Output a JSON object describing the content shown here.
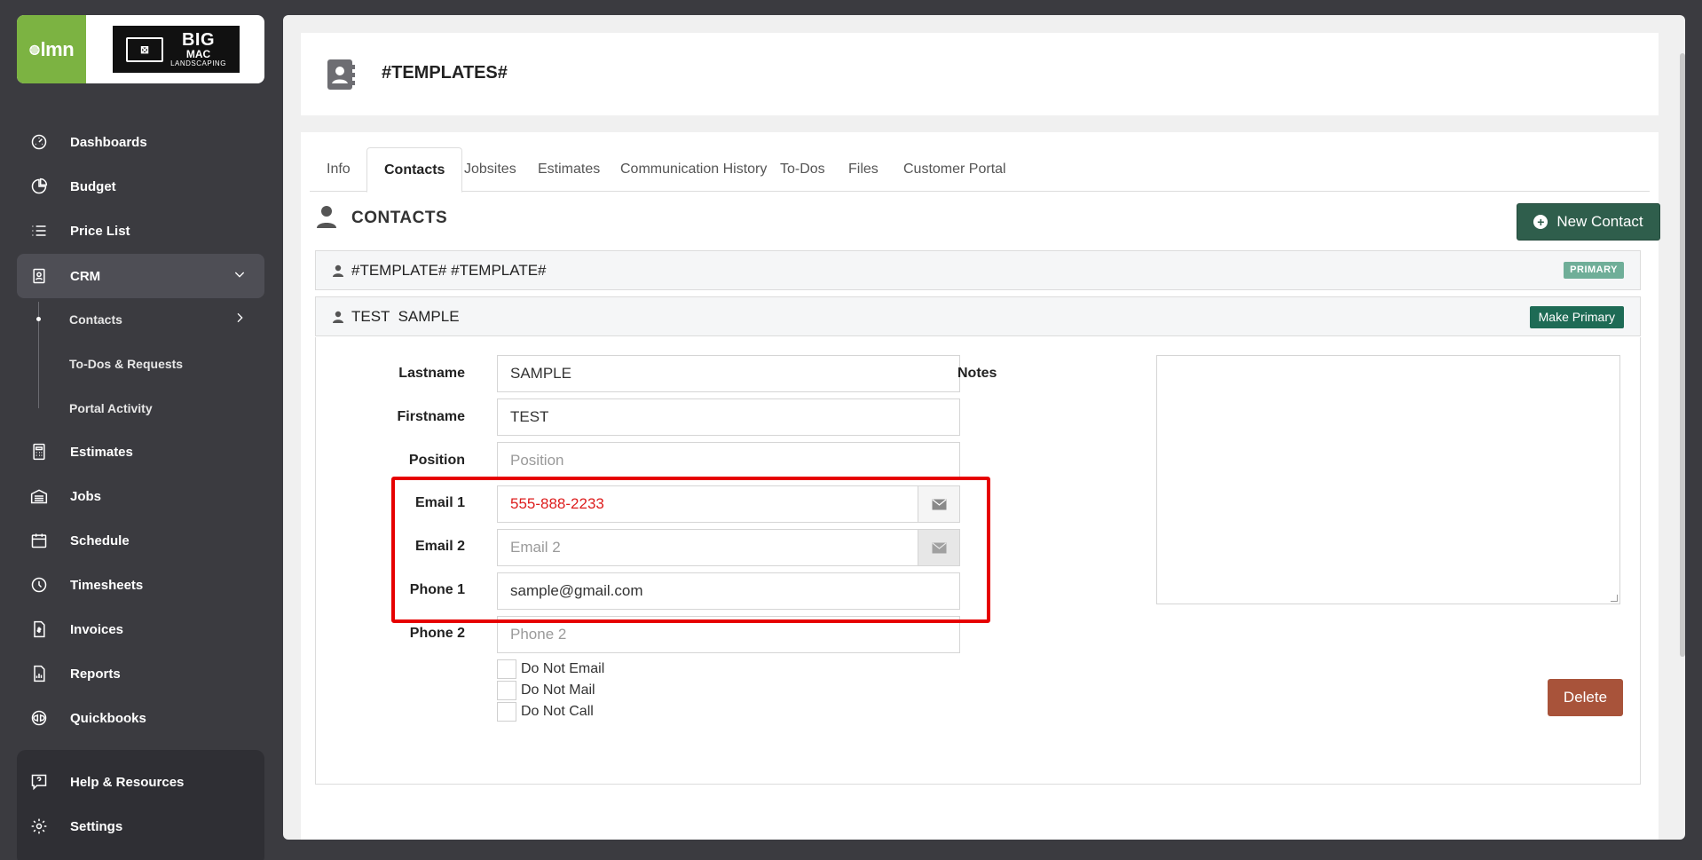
{
  "brand": {
    "app_logo": "lmn",
    "company_line1": "BIG",
    "company_line2": "MAC",
    "company_line3": "LANDSCAPING"
  },
  "sidebar": {
    "items": [
      {
        "label": "Dashboards",
        "icon": "gauge-icon"
      },
      {
        "label": "Budget",
        "icon": "pie-chart-icon"
      },
      {
        "label": "Price List",
        "icon": "list-icon"
      },
      {
        "label": "CRM",
        "icon": "contact-card-icon"
      },
      {
        "label": "Estimates",
        "icon": "calculator-icon"
      },
      {
        "label": "Jobs",
        "icon": "warehouse-icon"
      },
      {
        "label": "Schedule",
        "icon": "calendar-icon"
      },
      {
        "label": "Timesheets",
        "icon": "clock-icon"
      },
      {
        "label": "Invoices",
        "icon": "invoice-icon"
      },
      {
        "label": "Reports",
        "icon": "report-icon"
      },
      {
        "label": "Quickbooks",
        "icon": "quickbooks-icon"
      }
    ],
    "crm_sub": [
      "Contacts",
      "To-Dos & Requests",
      "Portal Activity"
    ],
    "help": {
      "label": "Help & Resources"
    },
    "settings": {
      "label": "Settings"
    }
  },
  "header": {
    "title": "#TEMPLATES#"
  },
  "tabs": [
    "Info",
    "Contacts",
    "Jobsites",
    "Estimates",
    "Communication History",
    "To-Dos",
    "Files",
    "Customer Portal"
  ],
  "contacts": {
    "title": "CONTACTS",
    "new_button": "New Contact",
    "primary_contact": {
      "name": "#TEMPLATE# #TEMPLATE#",
      "badge": "PRIMARY"
    },
    "selected_contact": {
      "name": "TEST  SAMPLE",
      "make_primary": "Make Primary"
    }
  },
  "form": {
    "lastname": {
      "label": "Lastname",
      "value": "SAMPLE"
    },
    "firstname": {
      "label": "Firstname",
      "value": "TEST"
    },
    "position": {
      "label": "Position",
      "placeholder": "Position"
    },
    "email1": {
      "label": "Email 1",
      "value": "555-888-2233"
    },
    "email2": {
      "label": "Email 2",
      "placeholder": "Email 2"
    },
    "phone1": {
      "label": "Phone 1",
      "value": "sample@gmail.com"
    },
    "phone2": {
      "label": "Phone 2",
      "placeholder": "Phone 2"
    },
    "checkboxes": [
      "Do Not Email",
      "Do Not Mail",
      "Do Not Call"
    ],
    "notes_label": "Notes",
    "delete": "Delete"
  },
  "colors": {
    "highlight": "#e60000",
    "accent": "#2f5e4c",
    "delete": "#a8533a",
    "brand_green": "#7cb342"
  }
}
